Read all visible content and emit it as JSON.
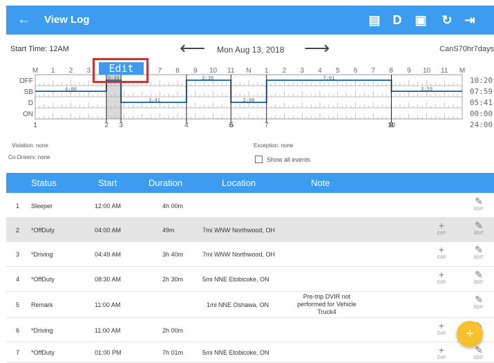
{
  "appbar": {
    "title": "View Log",
    "back_icon": "←",
    "icons": [
      {
        "name": "message-icon",
        "glyph": "▤"
      },
      {
        "name": "driver-d-icon",
        "glyph": "D"
      },
      {
        "name": "certify-icon",
        "glyph": "▣"
      },
      {
        "name": "refresh-icon",
        "glyph": "↻"
      },
      {
        "name": "logout-icon",
        "glyph": "⇥"
      }
    ]
  },
  "header": {
    "start_time": "Start Time: 12AM",
    "date": "Mon Aug 13, 2018",
    "cycle": "CanS70hr7days",
    "prev_icon": "⟵",
    "next_icon": "⟶"
  },
  "edit_label": "Edit",
  "graph": {
    "hour_labels": [
      "M",
      "1",
      "2",
      "3",
      "4",
      "5",
      "6",
      "7",
      "8",
      "9",
      "10",
      "11",
      "N",
      "1",
      "2",
      "3",
      "4",
      "5",
      "6",
      "7",
      "8",
      "9",
      "10",
      "11",
      "M"
    ],
    "status_labels": [
      "OFF",
      "SB",
      "D",
      "ON"
    ],
    "totals": [
      "10:20",
      "07:59",
      "05:41",
      "00:00",
      "24:00"
    ],
    "segment_labels": [
      "4:00",
      "0:49",
      "3:41",
      "2:30",
      "2:00",
      "7:01",
      "3:59"
    ],
    "event_numbers": [
      "1",
      "2",
      "3",
      "4",
      "6",
      "5",
      "7",
      "8",
      "10",
      "9"
    ]
  },
  "info": {
    "violation": "Violation: none",
    "codrivers": "Co-Drivers: none",
    "exception": "Exception: none",
    "show_all": "Show all events"
  },
  "table": {
    "headers": {
      "status": "Status",
      "start": "Start",
      "duration": "Duration",
      "location": "Location",
      "note": "Note"
    },
    "exp_label": "EXP",
    "edit_label": "EDIT",
    "plus_icon": "+",
    "pencil_icon": "✎",
    "rows": [
      {
        "num": "1",
        "status": "Sleeper",
        "start": "12:00 AM",
        "duration": "4h 00m",
        "location": "",
        "note": "",
        "exp": false,
        "selected": false
      },
      {
        "num": "2",
        "status": "*OffDuty",
        "start": "04:00 AM",
        "duration": "49m",
        "location": "7mi WNW Northwood, OH",
        "note": "",
        "exp": true,
        "selected": true
      },
      {
        "num": "3",
        "status": "*Driving",
        "start": "04:49 AM",
        "duration": "3h 40m",
        "location": "7mi WNW Northwood, OH",
        "note": "",
        "exp": true,
        "selected": false
      },
      {
        "num": "4",
        "status": "*OffDuty",
        "start": "08:30 AM",
        "duration": "2h 30m",
        "location": "5mi NNE Etobicoke, ON",
        "note": "",
        "exp": true,
        "selected": false
      },
      {
        "num": "5",
        "status": "Remark",
        "start": "11:00 AM",
        "duration": "",
        "location": "1mi NNE Oshawa, ON",
        "note": "Pre-trip DVIR not performed for Vehicle Truck4",
        "exp": false,
        "selected": false
      },
      {
        "num": "6",
        "status": "*Driving",
        "start": "11:00 AM",
        "duration": "2h 00m",
        "location": "",
        "note": "",
        "exp": true,
        "selected": false
      },
      {
        "num": "7",
        "status": "*OffDuty",
        "start": "01:00 PM",
        "duration": "7h 01m",
        "location": "5mi NNE Etobicoke, ON",
        "note": "",
        "exp": true,
        "selected": false
      }
    ]
  },
  "fab_icon": "+",
  "colors": {
    "accent": "#3d9cf0",
    "line": "#2f6fb0",
    "fab": "#f8c02d",
    "highlight": "#d32f2f"
  }
}
